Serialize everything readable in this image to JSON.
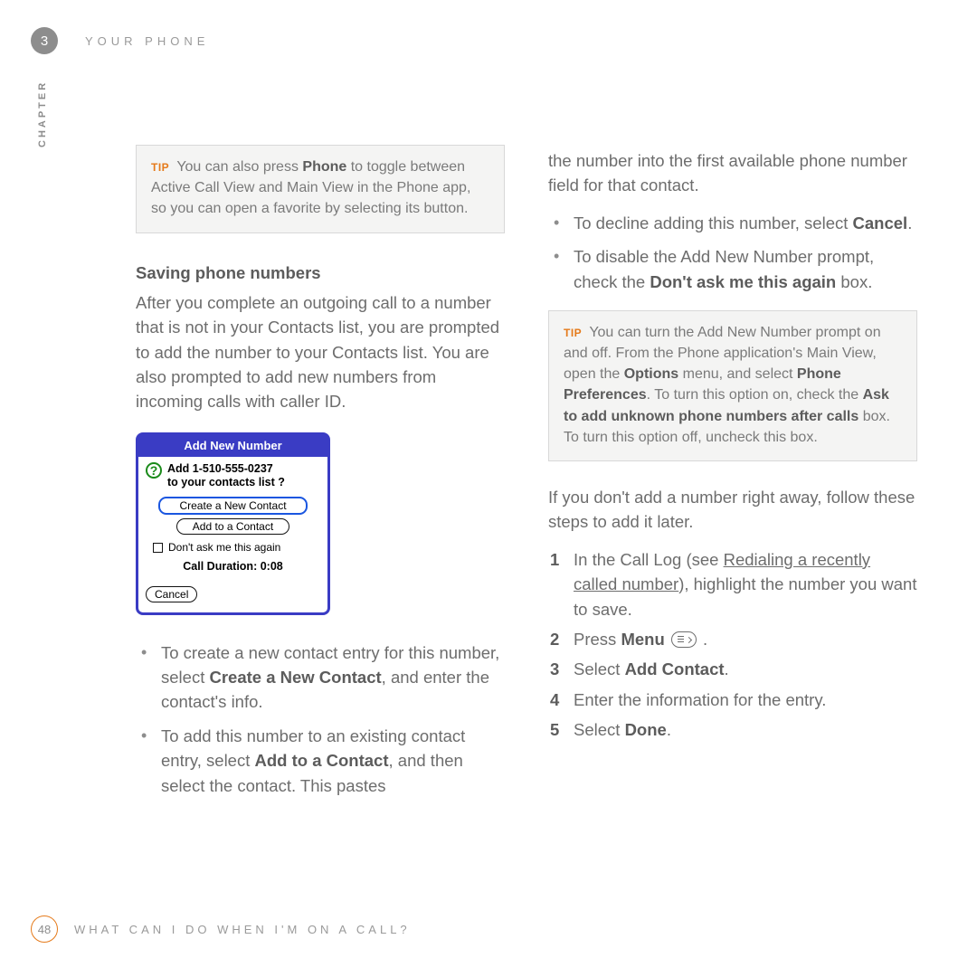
{
  "header": {
    "chapter_number": "3",
    "title": "YOUR PHONE",
    "chapter_label": "CHAPTER"
  },
  "footer": {
    "page_number": "48",
    "text": "WHAT CAN I DO WHEN I'M ON A CALL?"
  },
  "tip1": {
    "label": "TIP",
    "text_a": " You can also press ",
    "bold_a": "Phone",
    "text_b": " to toggle between Active Call View and Main View in the Phone app, so you can open a favorite by selecting its button."
  },
  "section": {
    "heading": "Saving phone numbers",
    "intro": "After you complete an outgoing call to a number that is not in your Contacts list, you are prompted to add the number to your Contacts list. You are also prompted to add new numbers from incoming calls with caller ID."
  },
  "dialog": {
    "title": "Add New Number",
    "prompt_line1": "Add 1-510-555-0237",
    "prompt_line2": "to your contacts list ?",
    "btn_create": "Create a New Contact",
    "btn_add": "Add to a Contact",
    "checkbox": "Don't ask me this again",
    "duration": "Call Duration: 0:08",
    "btn_cancel": "Cancel"
  },
  "left_bullets": {
    "b1_a": "To create a new contact entry for this number, select ",
    "b1_bold": "Create a New Contact",
    "b1_b": ", and enter the contact's info.",
    "b2_a": "To add this number to an existing contact entry, select ",
    "b2_bold": "Add to a Contact",
    "b2_b": ", and then select the contact. This pastes"
  },
  "right_top": {
    "cont": "the number into the first available phone number field for that contact.",
    "b1_a": "To decline adding this number, select ",
    "b1_bold": "Cancel",
    "b1_b": ".",
    "b2_a": "To disable the Add New Number prompt, check the ",
    "b2_bold": "Don't ask me this again",
    "b2_b": " box."
  },
  "tip2": {
    "label": "TIP",
    "t1": " You can turn the Add New Number prompt on and off. From the Phone application's Main View, open the ",
    "b1": "Options",
    "t2": " menu, and select ",
    "b2": "Phone Preferences",
    "t3": ". To turn this option on, check the ",
    "b3": "Ask to add unknown phone numbers after calls",
    "t4": " box. To turn this option off, uncheck this box."
  },
  "later": {
    "intro": "If you don't add a number right away, follow these steps to add it later.",
    "s1_a": "In the Call Log (see ",
    "s1_link": "Redialing a recently called number",
    "s1_b": "), highlight the number you want to save.",
    "s2_a": "Press ",
    "s2_bold": "Menu",
    "s2_b": " .",
    "s3_a": "Select ",
    "s3_bold": "Add Contact",
    "s3_b": ".",
    "s4": "Enter the information for the entry.",
    "s5_a": "Select ",
    "s5_bold": "Done",
    "s5_b": "."
  }
}
